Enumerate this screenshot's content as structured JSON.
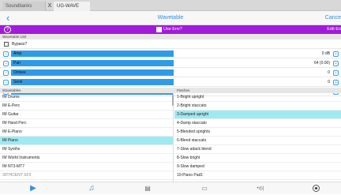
{
  "tabs": [
    {
      "label": "Soundbanks"
    },
    {
      "label": "UG-WAVE"
    }
  ],
  "tab_close": "X",
  "nav": {
    "back_icon": "‹",
    "title": "Wavetable",
    "cancel": "Cance"
  },
  "envbar": {
    "help_icon": "?",
    "use_env_label": "Use Env?",
    "use_env_checked": false,
    "edit_env": "Edit En"
  },
  "sections": {
    "wavetable_unit": "Wavetable Unit",
    "wavetables": "Wavetables",
    "patches": "Patches"
  },
  "bypass": {
    "label": "Bypass?",
    "checked": false
  },
  "sliders": [
    {
      "label": "Amp",
      "value": "0 dB",
      "fill": 1.0
    },
    {
      "label": "Pan",
      "value": "64 (0.00)",
      "fill": 1.0
    },
    {
      "label": "Octave",
      "value": "0",
      "fill": 1.0
    },
    {
      "label": "Semi",
      "value": "0",
      "fill": 1.0
    },
    {
      "label": "Cents",
      "value": "0",
      "fill": 1.0
    }
  ],
  "wavetables": [
    {
      "label": "IM Drums",
      "selected": false,
      "faded": false
    },
    {
      "label": "IM E-Perc",
      "selected": false,
      "faded": false
    },
    {
      "label": "IM Guitar",
      "selected": false,
      "faded": false
    },
    {
      "label": "IM Hand Perc",
      "selected": false,
      "faded": false
    },
    {
      "label": "IM E-Piano",
      "selected": false,
      "faded": false
    },
    {
      "label": "IM Piano",
      "selected": true,
      "faded": false
    },
    {
      "label": "IM Synths",
      "selected": false,
      "faded": false
    },
    {
      "label": "IM World Instruments",
      "selected": false,
      "faded": false
    },
    {
      "label": "IM NT3-MT7",
      "selected": false,
      "faded": false
    },
    {
      "label": "30THCENT SF3",
      "selected": false,
      "faded": true
    }
  ],
  "patches": [
    {
      "label": "1-Bright upright",
      "selected": false
    },
    {
      "label": "2-Bright staccato",
      "selected": false
    },
    {
      "label": "3-Damped upright",
      "selected": true
    },
    {
      "label": "4-Damp staccato",
      "selected": false
    },
    {
      "label": "5-Blended uprights",
      "selected": false
    },
    {
      "label": "6-Blend staccato",
      "selected": false
    },
    {
      "label": "7-Slow attack blend",
      "selected": false
    },
    {
      "label": "8-Slow bright",
      "selected": false
    },
    {
      "label": "9-Slow damped",
      "selected": false
    },
    {
      "label": "10-Piano Pad1",
      "selected": false
    }
  ],
  "toolbar": [
    {
      "icon": "play-icon",
      "glyph": "▶"
    },
    {
      "icon": "music-note-icon",
      "glyph": "♫"
    },
    {
      "icon": "document-icon",
      "glyph": "▤"
    },
    {
      "icon": "image-icon",
      "glyph": "▭"
    },
    {
      "icon": "midi-icon",
      "glyph": "•◎|"
    },
    {
      "icon": "record-icon",
      "glyph": ""
    }
  ],
  "colors": {
    "accent": "#2f8fe0",
    "envbar": "#a21bd8",
    "selection": "#9eeaf2",
    "slider_fill": "#2f9be8"
  }
}
